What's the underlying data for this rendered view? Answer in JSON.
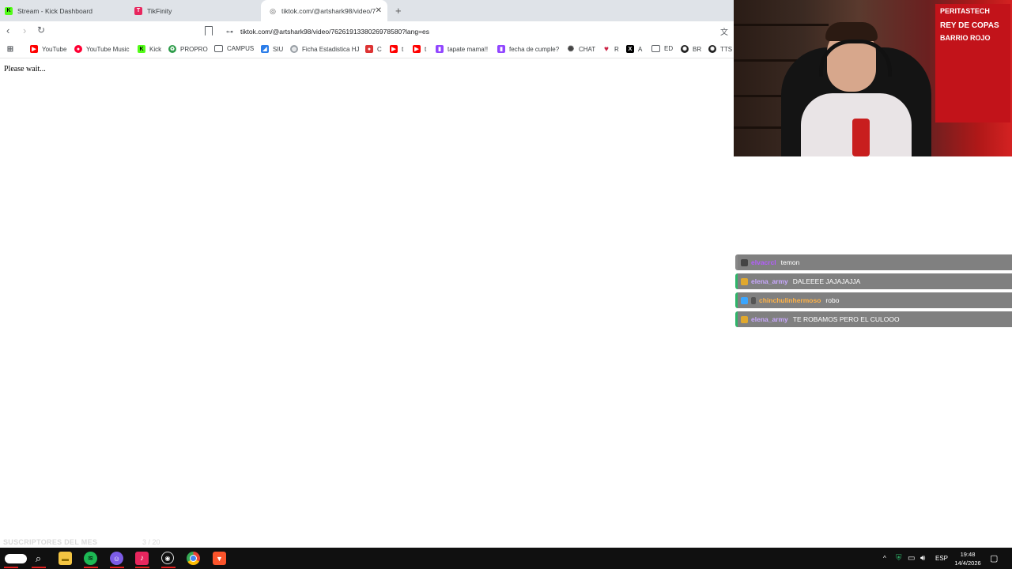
{
  "browser": {
    "tabs": [
      {
        "title": "Stream - Kick Dashboard",
        "favicon_color": "#53fc18",
        "favicon_glyph": "K"
      },
      {
        "title": "TikFinity",
        "favicon_color": "#e8265e",
        "favicon_glyph": "T"
      },
      {
        "title": "tiktok.com/@artshark98/video/7",
        "favicon_color": "#555555",
        "favicon_glyph": "◎"
      }
    ],
    "new_tab_icon": "plus-icon",
    "url": "tiktok.com/@artshark98/video/7626191338026978580?lang=es",
    "bookmarks": [
      {
        "label": "",
        "icon": "apps-grid-icon",
        "color": "#5f6368"
      },
      {
        "label": "YouTube",
        "icon": "youtube-icon",
        "color": "#ff0000"
      },
      {
        "label": "YouTube Music",
        "icon": "youtube-music-icon",
        "color": "#ff0033"
      },
      {
        "label": "Kick",
        "icon": "kick-icon",
        "color": "#53fc18"
      },
      {
        "label": "PROPRO",
        "icon": "recycle-icon",
        "color": "#2e9c4a"
      },
      {
        "label": "CAMPUS",
        "icon": "folder-icon",
        "color": "#5f6368"
      },
      {
        "label": "SIU",
        "icon": "siu-icon",
        "color": "#2b7de9"
      },
      {
        "label": "Ficha Estadistica HJ",
        "icon": "globe-icon",
        "color": "#5f6368"
      },
      {
        "label": "C",
        "icon": "c-app-icon",
        "color": "#d33"
      },
      {
        "label": "t",
        "icon": "youtube-icon",
        "color": "#ff0000"
      },
      {
        "label": "t",
        "icon": "youtube-icon",
        "color": "#ff0000"
      },
      {
        "label": "tapate mama!!",
        "icon": "twitch-icon",
        "color": "#9146ff"
      },
      {
        "label": "fecha de cumple?",
        "icon": "twitch-icon",
        "color": "#9146ff"
      },
      {
        "label": "CHAT",
        "icon": "openai-icon",
        "color": "#444444"
      },
      {
        "label": "R",
        "icon": "r-app-icon",
        "color": "#cc2244"
      },
      {
        "label": "A",
        "icon": "x-icon",
        "color": "#000000"
      },
      {
        "label": "ED",
        "icon": "folder-icon",
        "color": "#5f6368"
      },
      {
        "label": "BR",
        "icon": "openai-icon",
        "color": "#222222"
      },
      {
        "label": "TTS",
        "icon": "openai-icon",
        "color": "#222222"
      }
    ]
  },
  "page": {
    "status_text": "Please wait..."
  },
  "chat": {
    "messages": [
      {
        "user": "elvacrcl",
        "text": "temon",
        "user_color": "#b45cff",
        "badge_color": "#444444"
      },
      {
        "user": "elena_army",
        "text": "DALEEEE JAJAJAJJA",
        "user_color": "#c9a8ff",
        "badge_color": "#e0a82e"
      },
      {
        "user": "chinchulinhermoso",
        "text": "robo",
        "user_color": "#ffb347",
        "badge_color": "#3aa6ff"
      },
      {
        "user": "elena_army",
        "text": "TE ROBAMOS PERO EL CULOOO",
        "user_color": "#c9a8ff",
        "badge_color": "#e0a82e"
      }
    ]
  },
  "overlay": {
    "subs_label": "SUSCRIPTORES DEL MES",
    "subs_count": "3 / 20"
  },
  "webcam": {
    "poster_lines": [
      "PERITASTECH",
      "REY DE COPAS",
      "BARRIO ROJO"
    ]
  },
  "taskbar": {
    "apps": [
      "start-icon",
      "search-icon",
      "file-explorer-icon",
      "spotify-icon",
      "discord-icon",
      "tiktok-icon",
      "obs-icon",
      "chrome-icon",
      "brave-icon"
    ],
    "language": "ESP",
    "time": "19:48",
    "date": "14/4/2026"
  }
}
